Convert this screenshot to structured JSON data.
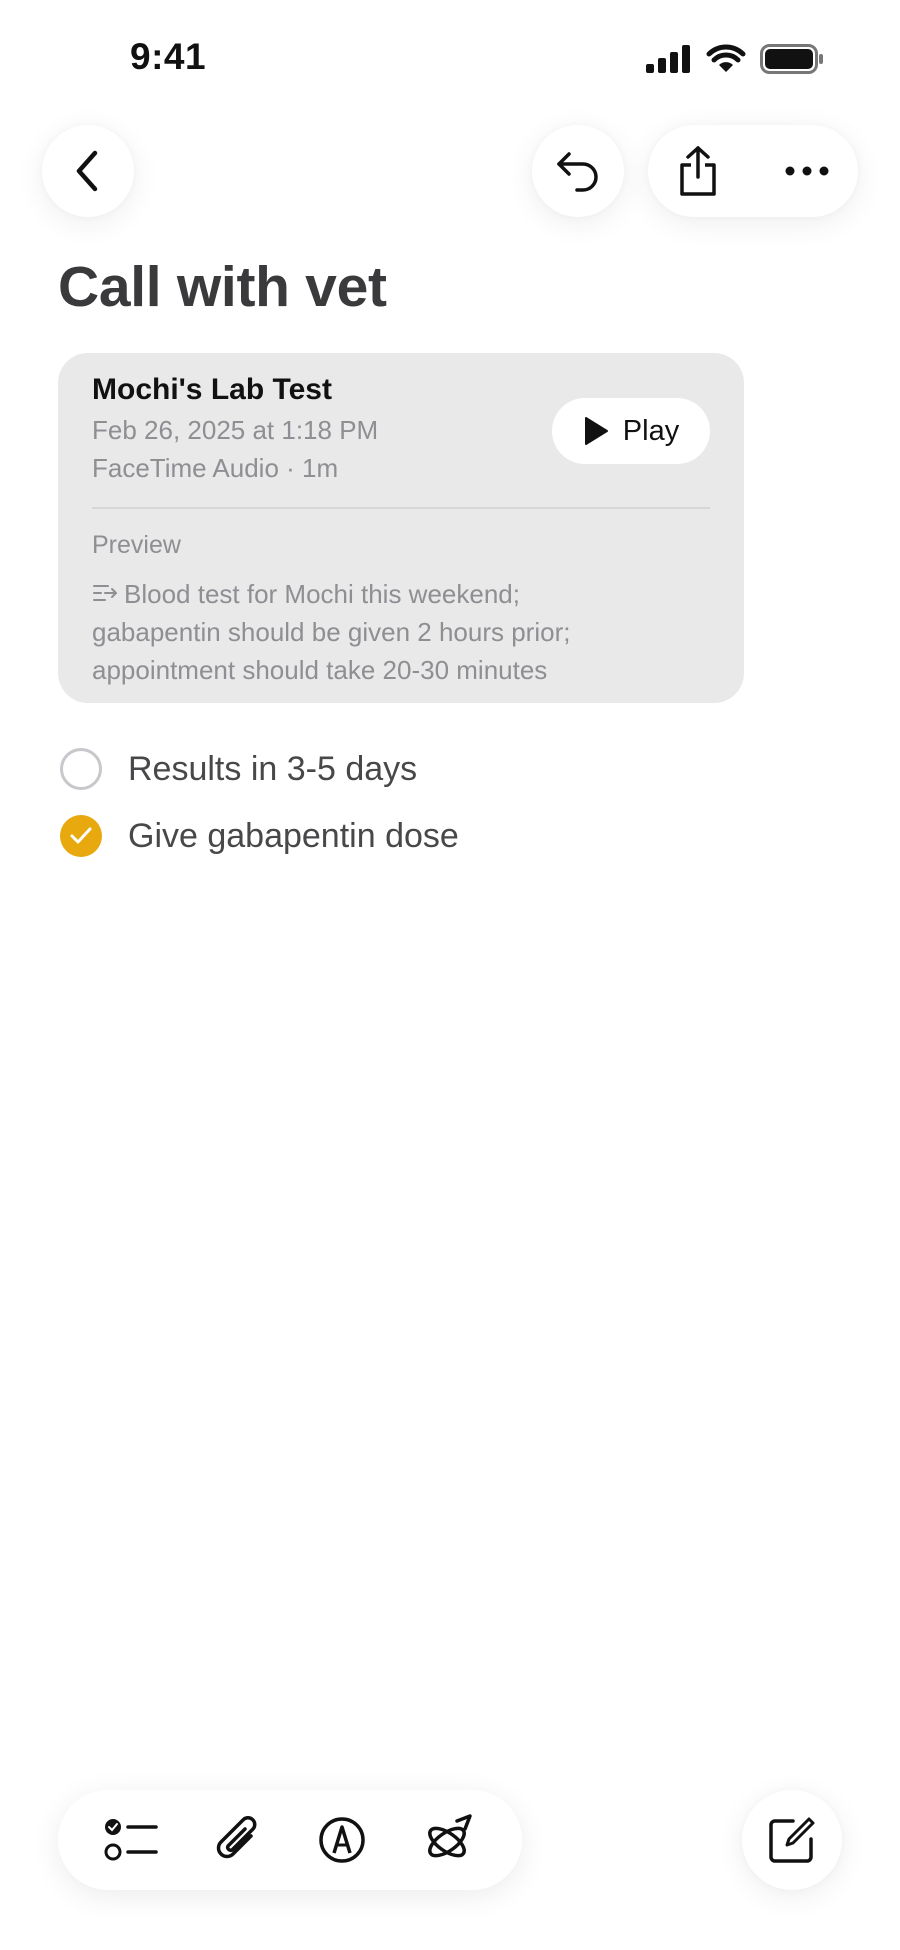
{
  "status_bar": {
    "time": "9:41",
    "icons": [
      "signal-icon",
      "wifi-icon",
      "battery-icon"
    ]
  },
  "nav": {
    "back_icon": "chevron-left-icon",
    "undo_icon": "undo-icon",
    "share_icon": "share-icon",
    "more_icon": "ellipsis-icon"
  },
  "note": {
    "title": "Call with vet"
  },
  "recording": {
    "title": "Mochi's Lab Test",
    "date": "Feb 26, 2025 at 1:18 PM",
    "meta": "FaceTime Audio · 1m",
    "play_label": "Play",
    "preview_label": "Preview",
    "preview_text": "Blood test for Mochi this weekend; gabapentin should be given 2 hours prior; appointment should take 20-30 minutes"
  },
  "checklist": [
    {
      "label": "Results in 3-5 days",
      "checked": false
    },
    {
      "label": "Give gabapentin dose",
      "checked": true
    }
  ],
  "toolbar": {
    "icons": [
      "checklist-icon",
      "attachment-icon",
      "markup-icon",
      "writing-tools-icon"
    ],
    "compose_icon": "compose-icon"
  },
  "colors": {
    "accent": "#e8a90e",
    "card_bg": "#e9e9e9",
    "title": "#3a3a3c",
    "secondary_text": "#8e8e93"
  }
}
